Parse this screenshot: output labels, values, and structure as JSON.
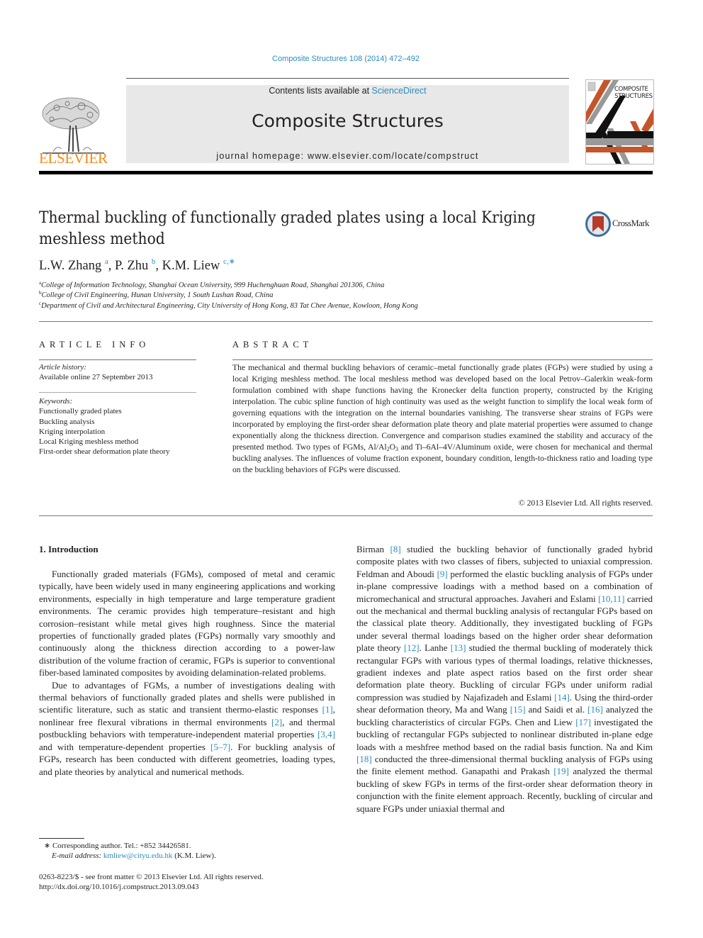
{
  "header": {
    "journal_ref": "Composite Structures 108 (2014) 472–492",
    "contents_prefix": "Contents lists available at ",
    "contents_link": "ScienceDirect",
    "journal_name": "Composite Structures",
    "homepage_prefix": "journal homepage: ",
    "homepage_url": "www.elsevier.com/locate/compstruct",
    "publisher_logo_text": "ELSEVIER",
    "cover_text_1": "COMPOSITE",
    "cover_text_2": "STRUCTURES",
    "colors": {
      "link": "#2b8cbf",
      "elsevier_orange": "#f28a1d",
      "cover_orange": "#c4552b"
    }
  },
  "article": {
    "title": "Thermal buckling of functionally graded plates using a local Kriging meshless method",
    "crossmark_label": "CrossMark",
    "authors": [
      {
        "name": "L.W. Zhang",
        "sup": "a"
      },
      {
        "name": "P. Zhu",
        "sup": "b"
      },
      {
        "name": "K.M. Liew",
        "sup": "c,∗"
      }
    ],
    "affiliations": [
      {
        "sup": "a",
        "text": "College of Information Technology, Shanghai Ocean University, 999 Huchenghuan Road, Shanghai 201306, China"
      },
      {
        "sup": "b",
        "text": "College of Civil Engineering, Hunan University, 1 South Lushan Road, China"
      },
      {
        "sup": "c",
        "text": "Department of Civil and Architectural Engineering, City University of Hong Kong, 83 Tat Chee Avenue, Kowloon, Hong Kong"
      }
    ]
  },
  "article_info": {
    "heading": "ARTICLE INFO",
    "history_label": "Article history:",
    "history_value": "Available online 27 September 2013",
    "keywords_label": "Keywords:",
    "keywords": [
      "Functionally graded plates",
      "Buckling analysis",
      "Kriging interpolation",
      "Local Kriging meshless method",
      "First-order shear deformation plate theory"
    ]
  },
  "abstract": {
    "heading": "ABSTRACT",
    "text_1": "The mechanical and thermal buckling behaviors of ceramic–metal functionally grade plates (FGPs) were studied by using a local Kriging meshless method. The local meshless method was developed based on the local Petrov–Galerkin weak-form formulation combined with shape functions having the Kronecker delta function property, constructed by the Kriging interpolation. The cubic spline function of high continuity was used as the weight function to simplify the local weak form of governing equations with the integration on the internal boundaries vanishing. The transverse shear strains of FGPs were incorporated by employing the first-order shear deformation plate theory and plate material properties were assumed to change exponentially along the thickness direction. Convergence and comparison studies examined the stability and accuracy of the presented method. Two types of FGMs, Al/Al",
    "sub_1": "2",
    "text_2": "O",
    "sub_2": "3",
    "text_3": " and Ti–6Al–4V/Aluminum oxide, were chosen for mechanical and thermal buckling analyses. The influences of volume fraction exponent, boundary condition, length-to-thickness ratio and loading type on the buckling behaviors of FGPs were discussed.",
    "copyright": "© 2013 Elsevier Ltd. All rights reserved."
  },
  "intro": {
    "heading": "1. Introduction",
    "p1": "Functionally graded materials (FGMs), composed of metal and ceramic typically, have been widely used in many engineering applications and working environments, especially in high temperature and large temperature gradient environments. The ceramic provides high temperature–resistant and high corrosion–resistant while metal gives high roughness. Since the material properties of functionally graded plates (FGPs) normally vary smoothly and continuously along the thickness direction according to a power-law distribution of the volume fraction of ceramic, FGPs is superior to conventional fiber-based laminated composites by avoiding delamination-related problems.",
    "p2": [
      "Due to advantages of FGMs, a number of investigations dealing with thermal behaviors of functionally graded plates and shells were published in scientific literature, such as static and transient thermo-elastic responses ",
      "[1]",
      ", nonlinear free flexural vibrations in thermal environments ",
      "[2]",
      ", and thermal postbuckling behaviors with temperature-independent material properties ",
      "[3,4]",
      " and with temperature-dependent properties ",
      "[5–7]",
      ". For buckling analysis of FGPs, research has been conducted with different geometries, loading types, and plate theories by analytical and numerical methods."
    ],
    "col2": [
      "Birman ",
      "[8]",
      " studied the buckling behavior of functionally graded hybrid composite plates with two classes of fibers, subjected to uniaxial compression. Feldman and Aboudi ",
      "[9]",
      " performed the elastic buckling analysis of FGPs under in-plane compressive loadings with a method based on a combination of micromechanical and structural approaches. Javaheri and Eslami ",
      "[10,11]",
      " carried out the mechanical and thermal buckling analysis of rectangular FGPs based on the classical plate theory. Additionally, they investigated buckling of FGPs under several thermal loadings based on the higher order shear deformation plate theory ",
      "[12]",
      ". Lanhe ",
      "[13]",
      " studied the thermal buckling of moderately thick rectangular FGPs with various types of thermal loadings, relative thicknesses, gradient indexes and plate aspect ratios based on the first order shear deformation plate theory. Buckling of circular FGPs under uniform radial compression was studied by Najafizadeh and Eslami ",
      "[14]",
      ". Using the third-order shear deformation theory, Ma and Wang ",
      "[15]",
      " and Saidi et al. ",
      "[16]",
      " analyzed the buckling characteristics of circular FGPs. Chen and Liew ",
      "[17]",
      " investigated the buckling of rectangular FGPs subjected to nonlinear distributed in-plane edge loads with a meshfree method based on the radial basis function. Na and Kim ",
      "[18]",
      " conducted the three-dimensional thermal buckling analysis of FGPs using the finite element method. Ganapathi and Prakash ",
      "[19]",
      " analyzed the thermal buckling of skew FGPs in terms of the first-order shear deformation theory in conjunction with the finite element approach. Recently, buckling of circular and square FGPs under uniaxial thermal and"
    ]
  },
  "footnotes": {
    "corresponding": "∗ Corresponding author. Tel.: +852 34426581.",
    "email_label": "E-mail address: ",
    "email": "kmliew@cityu.edu.hk",
    "email_suffix": " (K.M. Liew).",
    "issn_line": "0263-8223/$ - see front matter © 2013 Elsevier Ltd. All rights reserved.",
    "doi": "http://dx.doi.org/10.1016/j.compstruct.2013.09.043"
  }
}
